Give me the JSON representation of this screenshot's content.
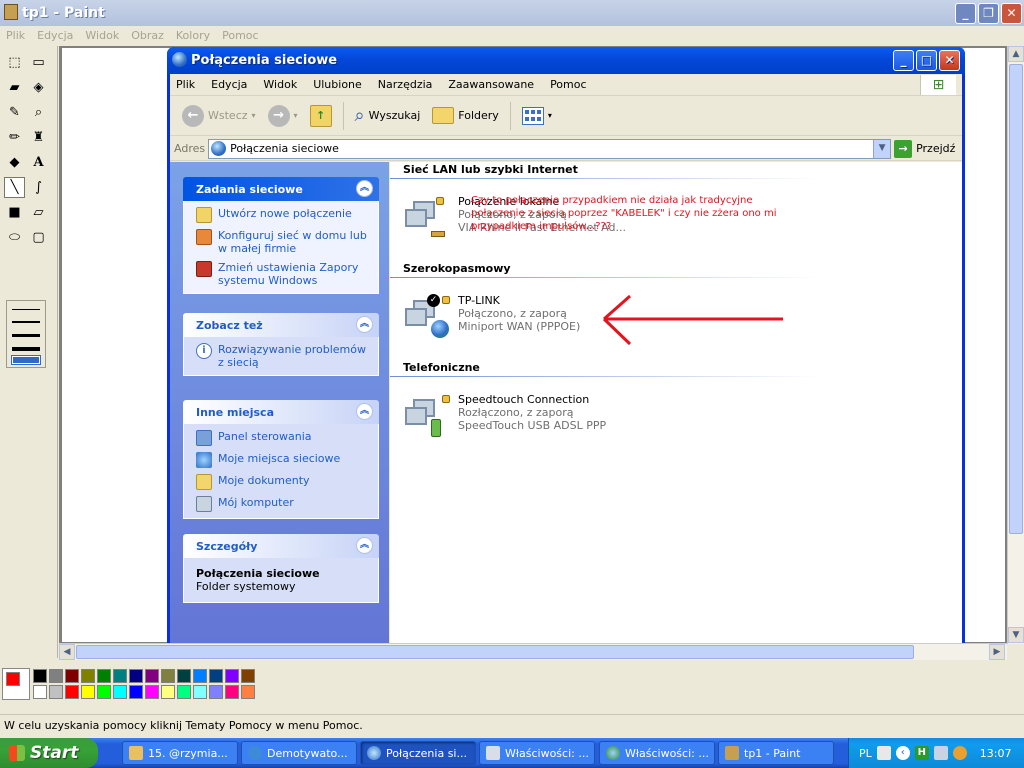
{
  "paint": {
    "title": "tp1 - Paint",
    "menu": [
      "Plik",
      "Edycja",
      "Widok",
      "Obraz",
      "Kolory",
      "Pomoc"
    ],
    "status": "W celu uzyskania pomocy kliknij Tematy Pomocy w menu Pomoc."
  },
  "window": {
    "title": "Połączenia sieciowe",
    "menu": [
      "Plik",
      "Edycja",
      "Widok",
      "Ulubione",
      "Narzędzia",
      "Zaawansowane",
      "Pomoc"
    ],
    "toolbar": {
      "back": "Wstecz",
      "search": "Wyszukaj",
      "folders": "Foldery"
    },
    "address": {
      "label": "Adres",
      "value": "Połączenia sieciowe",
      "go": "Przejdź"
    }
  },
  "panes": {
    "tasks": {
      "title": "Zadania sieciowe",
      "links": [
        "Utwórz nowe połączenie",
        "Konfiguruj sieć w domu lub w małej firmie",
        "Zmień ustawienia Zapory systemu Windows"
      ]
    },
    "see_also": {
      "title": "Zobacz też",
      "links": [
        "Rozwiązywanie problemów z siecią"
      ]
    },
    "other": {
      "title": "Inne miejsca",
      "links": [
        "Panel sterowania",
        "Moje miejsca sieciowe",
        "Moje dokumenty",
        "Mój komputer"
      ]
    },
    "details": {
      "title": "Szczegóły",
      "name": "Połączenia sieciowe",
      "type": "Folder systemowy"
    }
  },
  "groups": [
    {
      "title": "Sieć LAN lub szybki Internet",
      "conn": {
        "name": "Połączenie lokalne",
        "status": "Połączono, z zaporą",
        "device": "VIA Rhine II Fast Ethernet Ad..."
      }
    },
    {
      "title": "Szerokopasmowy",
      "conn": {
        "name": "TP-LINK",
        "status": "Połączono, z zaporą",
        "device": "Miniport WAN (PPPOE)"
      }
    },
    {
      "title": "Telefoniczne",
      "conn": {
        "name": "Speedtouch Connection",
        "status": "Rozłączono, z zaporą",
        "device": "SpeedTouch USB ADSL PPP"
      }
    }
  ],
  "annotation": "Czy to połączenie przypadkiem nie działa jak tradycyjne połączenie z siecią  poprzez \"KABELEK\" i czy nie zżera ono mi przypadkiem impulsów...???",
  "taskbar": {
    "start": "Start",
    "tasks": [
      "15. @rzymia...",
      "Demotywato...",
      "Połączenia si...",
      "Właściwości: ...",
      "Właściwości: ...",
      "tp1 - Paint"
    ],
    "lang": "PL",
    "clock": "13:07"
  },
  "colors": {
    "accent": "#215dc6",
    "annotation": "#e3141c",
    "palette_top": [
      "#000000",
      "#808080",
      "#800000",
      "#808000",
      "#008000",
      "#008080",
      "#000080",
      "#800080",
      "#808040",
      "#004040",
      "#0080ff",
      "#004080",
      "#8000ff",
      "#804000"
    ],
    "palette_bottom": [
      "#ffffff",
      "#c0c0c0",
      "#ff0000",
      "#ffff00",
      "#00ff00",
      "#00ffff",
      "#0000ff",
      "#ff00ff",
      "#ffff80",
      "#00ff80",
      "#80ffff",
      "#8080ff",
      "#ff0080",
      "#ff8040"
    ]
  }
}
